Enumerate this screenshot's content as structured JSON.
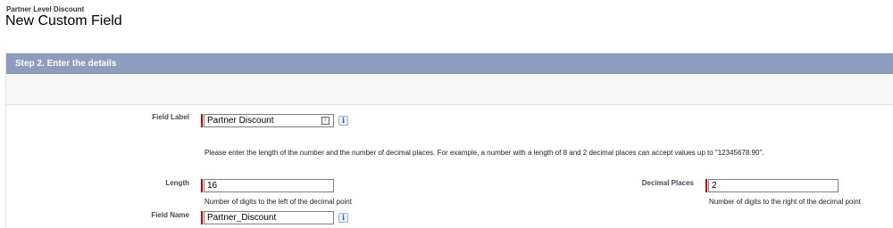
{
  "header": {
    "breadcrumb": "Partner Level Discount",
    "title": "New Custom Field"
  },
  "step": {
    "title": "Step 2. Enter the details"
  },
  "form": {
    "field_label": {
      "label": "Field Label",
      "value": "Partner Discount"
    },
    "instructions": "Please enter the length of the number and the number of decimal places. For example, a number with a length of 8 and 2 decimal places can accept values up to \"12345678.90\".",
    "length": {
      "label": "Length",
      "value": "16",
      "hint": "Number of digits to the left of the decimal point"
    },
    "decimal_places": {
      "label": "Decimal Places",
      "value": "2",
      "hint": "Number of digits to the right of the decimal point"
    },
    "field_name": {
      "label": "Field Name",
      "value": "Partner_Discount"
    },
    "info_glyph": "i",
    "lookup_glyph": "⁝"
  },
  "colors": {
    "header_bar": "#8e9dbe",
    "required": "#cc0000"
  },
  "icons": [
    "info-icon",
    "lookup-icon"
  ]
}
